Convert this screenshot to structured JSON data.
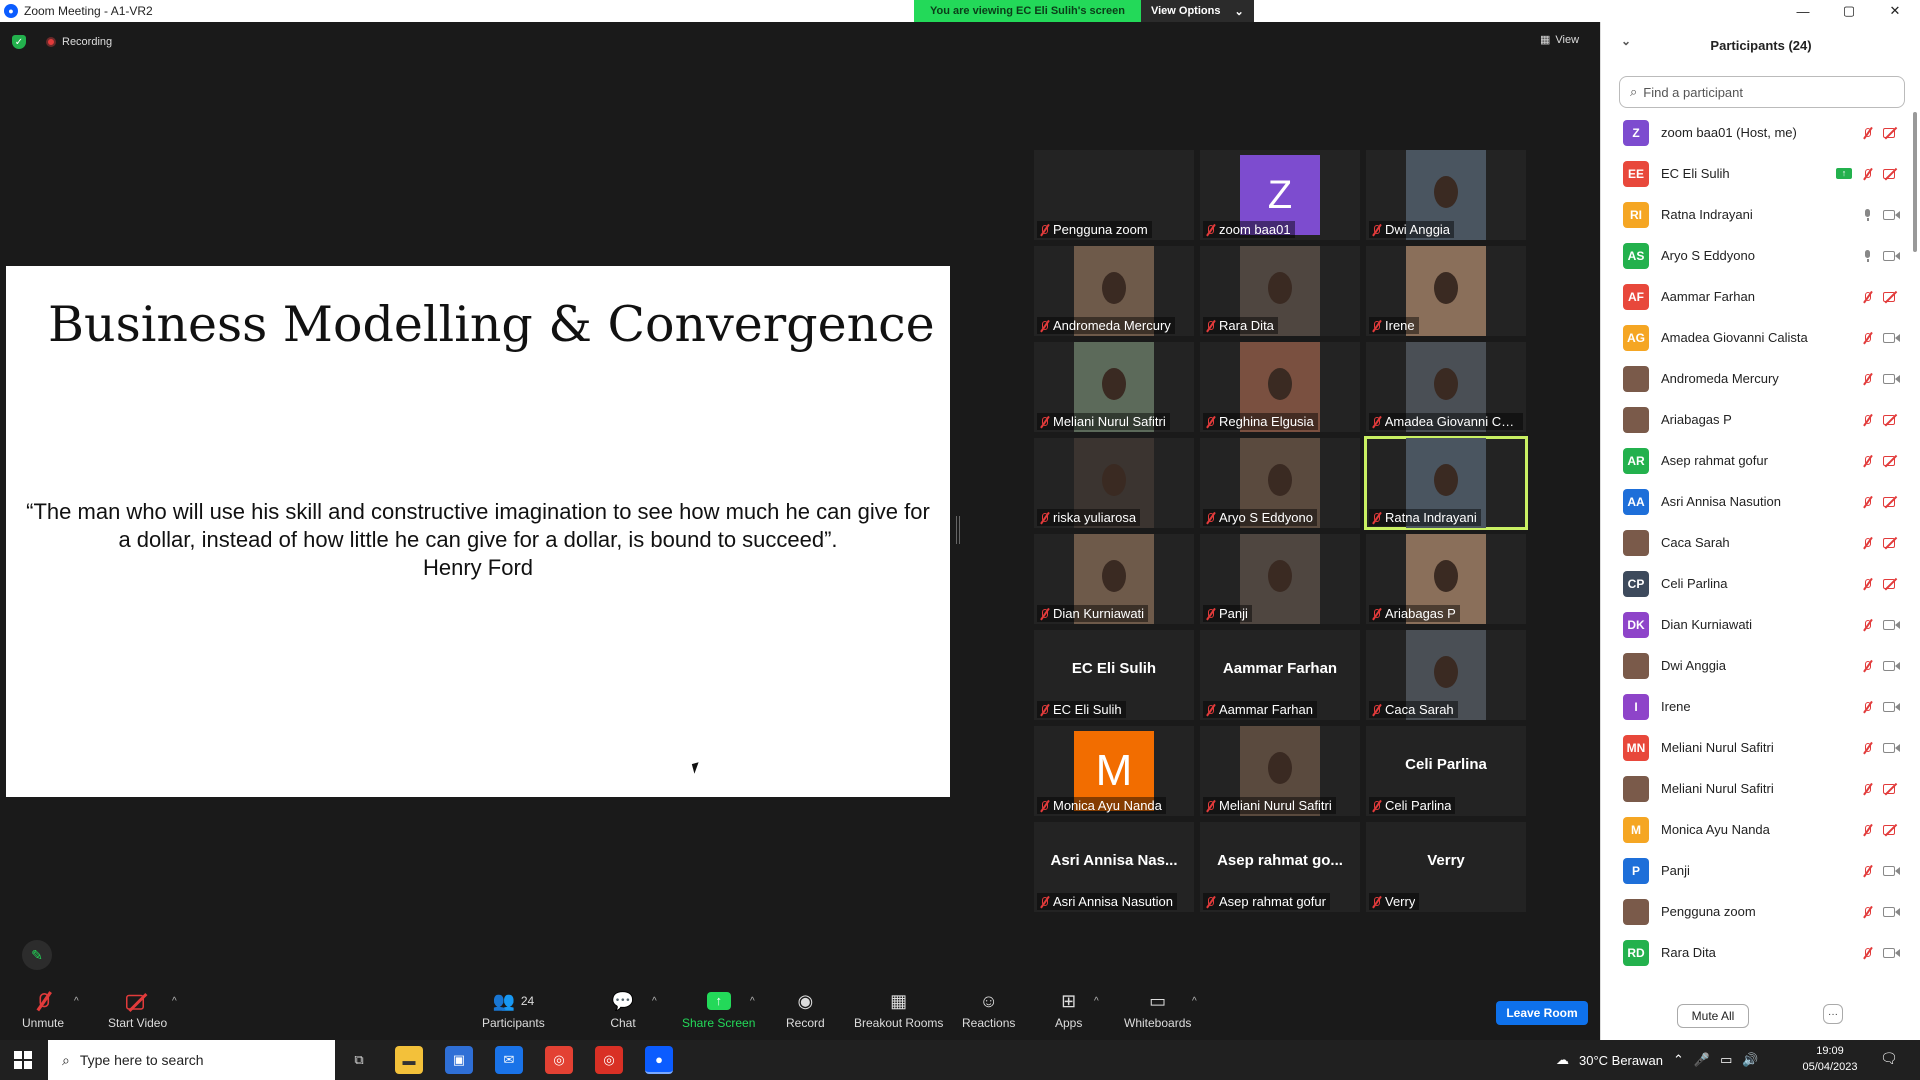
{
  "window": {
    "title": "Zoom Meeting - A1-VR2",
    "controls": [
      "—",
      "▢",
      "✕"
    ]
  },
  "banner": {
    "viewing": "You are viewing EC Eli Sulih's screen",
    "view_options": "View Options"
  },
  "topbar": {
    "recording": "Recording",
    "view": "View"
  },
  "slide": {
    "title": "Business Modelling & Convergence",
    "quote": "“The man who will use his skill and constructive imagination to see how much he can give for a dollar, instead of how little he can give for a dollar, is bound to succeed”.",
    "author": "Henry Ford"
  },
  "gallery": [
    {
      "name": "Pengguna zoom",
      "kind": "blank"
    },
    {
      "name": "zoom baa01",
      "kind": "avatar",
      "letter": "Z",
      "color": "#7d4ccf"
    },
    {
      "name": "Dwi Anggia",
      "kind": "video"
    },
    {
      "name": "Andromeda Mercury",
      "kind": "video"
    },
    {
      "name": "Rara Dita",
      "kind": "video"
    },
    {
      "name": "Irene",
      "kind": "video"
    },
    {
      "name": "Meliani Nurul Safitri",
      "kind": "video"
    },
    {
      "name": "Reghina Elgusia",
      "kind": "video"
    },
    {
      "name": "Amadea Giovanni Cal...",
      "kind": "video"
    },
    {
      "name": "riska yuliarosa",
      "kind": "video"
    },
    {
      "name": "Aryo S Eddyono",
      "kind": "video"
    },
    {
      "name": "Ratna Indrayani",
      "kind": "video",
      "active": true
    },
    {
      "name": "Dian Kurniawati",
      "kind": "video"
    },
    {
      "name": "Panji",
      "kind": "video"
    },
    {
      "name": "Ariabagas P",
      "kind": "video"
    },
    {
      "name": "EC Eli Sulih",
      "kind": "text",
      "big": "EC Eli Sulih"
    },
    {
      "name": "Aammar Farhan",
      "kind": "text",
      "big": "Aammar Farhan"
    },
    {
      "name": "Caca Sarah",
      "kind": "video"
    },
    {
      "name": "Monica Ayu Nanda",
      "kind": "avatar",
      "letter": "M",
      "color": "#f26d00"
    },
    {
      "name": "Meliani Nurul Safitri",
      "kind": "video"
    },
    {
      "name": "Celi Parlina",
      "kind": "text",
      "big": "Celi Parlina"
    },
    {
      "name": "Asri Annisa Nasution",
      "kind": "text",
      "big": "Asri Annisa Nas..."
    },
    {
      "name": "Asep rahmat gofur",
      "kind": "text",
      "big": "Asep rahmat go..."
    },
    {
      "name": "Verry",
      "kind": "text",
      "big": "Verry"
    }
  ],
  "toolbar": {
    "unmute": "Unmute",
    "start_video": "Start Video",
    "participants": "Participants",
    "participants_count": "24",
    "chat": "Chat",
    "share_screen": "Share Screen",
    "record": "Record",
    "breakout": "Breakout Rooms",
    "reactions": "Reactions",
    "apps": "Apps",
    "whiteboards": "Whiteboards",
    "leave": "Leave Room"
  },
  "panel": {
    "title": "Participants (24)",
    "search_placeholder": "Find a participant",
    "mute_all": "Mute All",
    "participants": [
      {
        "initials": "Z",
        "color": "#7d4ccf",
        "name": "zoom baa01 (Host, me)",
        "mic": "off",
        "video": "off"
      },
      {
        "initials": "EE",
        "color": "#e8483b",
        "name": "EC Eli Sulih",
        "mic": "off",
        "video": "off",
        "sharing": true
      },
      {
        "initials": "RI",
        "color": "#f5a623",
        "name": "Ratna Indrayani",
        "mic": "on",
        "video": "on"
      },
      {
        "initials": "AS",
        "color": "#23b14d",
        "name": "Aryo S Eddyono",
        "mic": "on",
        "video": "on"
      },
      {
        "initials": "AF",
        "color": "#e8483b",
        "name": "Aammar Farhan",
        "mic": "off",
        "video": "off"
      },
      {
        "initials": "AG",
        "color": "#f5a623",
        "name": "Amadea Giovanni Calista",
        "mic": "off",
        "video": "on"
      },
      {
        "initials": "",
        "color": "photo",
        "name": "Andromeda Mercury",
        "mic": "off",
        "video": "on"
      },
      {
        "initials": "",
        "color": "photo",
        "name": "Ariabagas P",
        "mic": "off",
        "video": "off"
      },
      {
        "initials": "AR",
        "color": "#23b14d",
        "name": "Asep rahmat gofur",
        "mic": "off",
        "video": "off"
      },
      {
        "initials": "AA",
        "color": "#1e6fd9",
        "name": "Asri Annisa Nasution",
        "mic": "off",
        "video": "off"
      },
      {
        "initials": "",
        "color": "photo",
        "name": "Caca Sarah",
        "mic": "off",
        "video": "off"
      },
      {
        "initials": "CP",
        "color": "#3d4a5c",
        "name": "Celi Parlina",
        "mic": "off",
        "video": "off"
      },
      {
        "initials": "DK",
        "color": "#8e44c9",
        "name": "Dian Kurniawati",
        "mic": "off",
        "video": "on"
      },
      {
        "initials": "",
        "color": "photo",
        "name": "Dwi Anggia",
        "mic": "off",
        "video": "on"
      },
      {
        "initials": "I",
        "color": "#8e44c9",
        "name": "Irene",
        "mic": "off",
        "video": "on"
      },
      {
        "initials": "MN",
        "color": "#e8483b",
        "name": "Meliani Nurul Safitri",
        "mic": "off",
        "video": "on"
      },
      {
        "initials": "",
        "color": "photo",
        "name": "Meliani Nurul Safitri",
        "mic": "off",
        "video": "off"
      },
      {
        "initials": "M",
        "color": "#f5a623",
        "name": "Monica Ayu Nanda",
        "mic": "off",
        "video": "off"
      },
      {
        "initials": "P",
        "color": "#1e6fd9",
        "name": "Panji",
        "mic": "off",
        "video": "on"
      },
      {
        "initials": "",
        "color": "photo",
        "name": "Pengguna zoom",
        "mic": "off",
        "video": "on"
      },
      {
        "initials": "RD",
        "color": "#23b14d",
        "name": "Rara Dita",
        "mic": "off",
        "video": "on"
      }
    ]
  },
  "taskbar": {
    "search_placeholder": "Type here to search",
    "weather": "30°C  Berawan",
    "time": "19:09",
    "date": "05/04/2023"
  }
}
